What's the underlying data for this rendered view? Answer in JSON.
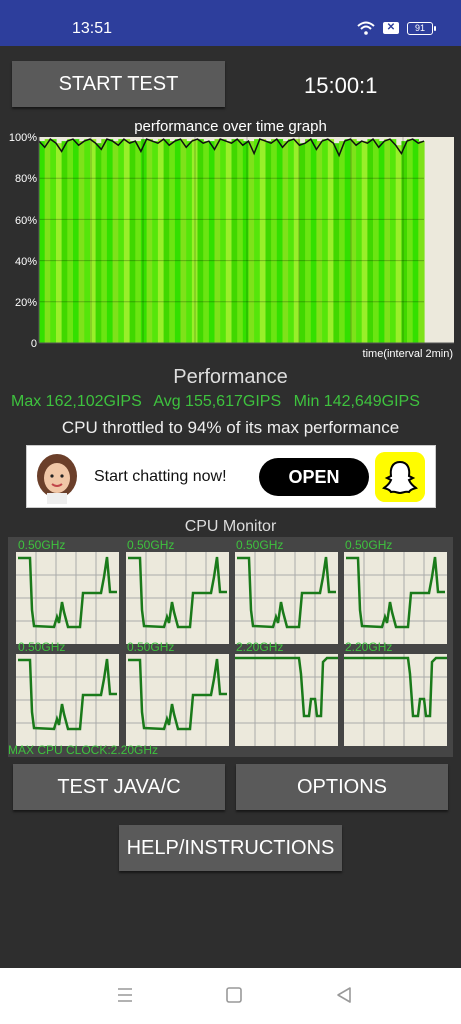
{
  "status_bar": {
    "time": "13:51",
    "battery": "91",
    "icons": [
      "wifi-icon",
      "sim-off-icon",
      "battery-icon"
    ]
  },
  "controls": {
    "start_test": "START TEST",
    "timer": "15:00:1",
    "test_java_c": "TEST JAVA/C",
    "options": "OPTIONS",
    "help": "HELP/INSTRUCTIONS"
  },
  "performance_graph": {
    "title": "performance over time graph",
    "y_ticks": [
      "100%",
      "80%",
      "60%",
      "40%",
      "20%",
      "0"
    ],
    "x_label": "time(interval 2min)"
  },
  "performance": {
    "title": "Performance",
    "max": "Max 162,102GIPS",
    "avg": "Avg 155,617GIPS",
    "min": "Min 142,649GIPS",
    "throttle": "CPU throttled to 94% of its max performance"
  },
  "ad": {
    "text": "Start chatting now!",
    "button": "OPEN"
  },
  "cpu_monitor": {
    "title": "CPU Monitor",
    "cores": [
      {
        "freq": "0.50GHz"
      },
      {
        "freq": "0.50GHz"
      },
      {
        "freq": "0.50GHz"
      },
      {
        "freq": "0.50GHz"
      },
      {
        "freq": "0.50GHz"
      },
      {
        "freq": "0.50GHz"
      },
      {
        "freq": "2.20GHz"
      },
      {
        "freq": "2.20GHz"
      }
    ],
    "max_clock": "MAX CPU CLOCK:2.20GHz"
  },
  "colors": {
    "status_bar": "#2d3e9c",
    "background": "#2e2e2e",
    "button": "#5a5a5a",
    "green_text": "#3ec23e",
    "graph_green": "#33e000",
    "graph_bg": "#ece9dc"
  },
  "chart_data": {
    "type": "area",
    "title": "performance over time graph",
    "xlabel": "time(interval 2min)",
    "ylabel": "",
    "ylim": [
      0,
      100
    ],
    "series": [
      {
        "values": [
          98,
          95,
          99,
          97,
          93,
          98,
          99,
          96,
          98,
          99,
          97,
          94,
          99,
          98,
          96,
          99,
          97,
          98,
          93,
          99,
          98,
          97,
          99,
          96,
          98,
          99,
          95,
          98,
          99,
          97,
          98,
          94,
          99,
          98,
          97,
          99,
          96,
          98,
          92,
          99,
          98,
          97,
          99,
          95,
          98,
          99,
          96,
          97,
          99,
          94,
          98,
          99,
          97,
          91,
          98,
          99,
          96,
          98,
          97,
          99,
          95,
          98,
          99,
          96,
          92,
          98,
          99,
          97,
          98
        ]
      }
    ]
  }
}
